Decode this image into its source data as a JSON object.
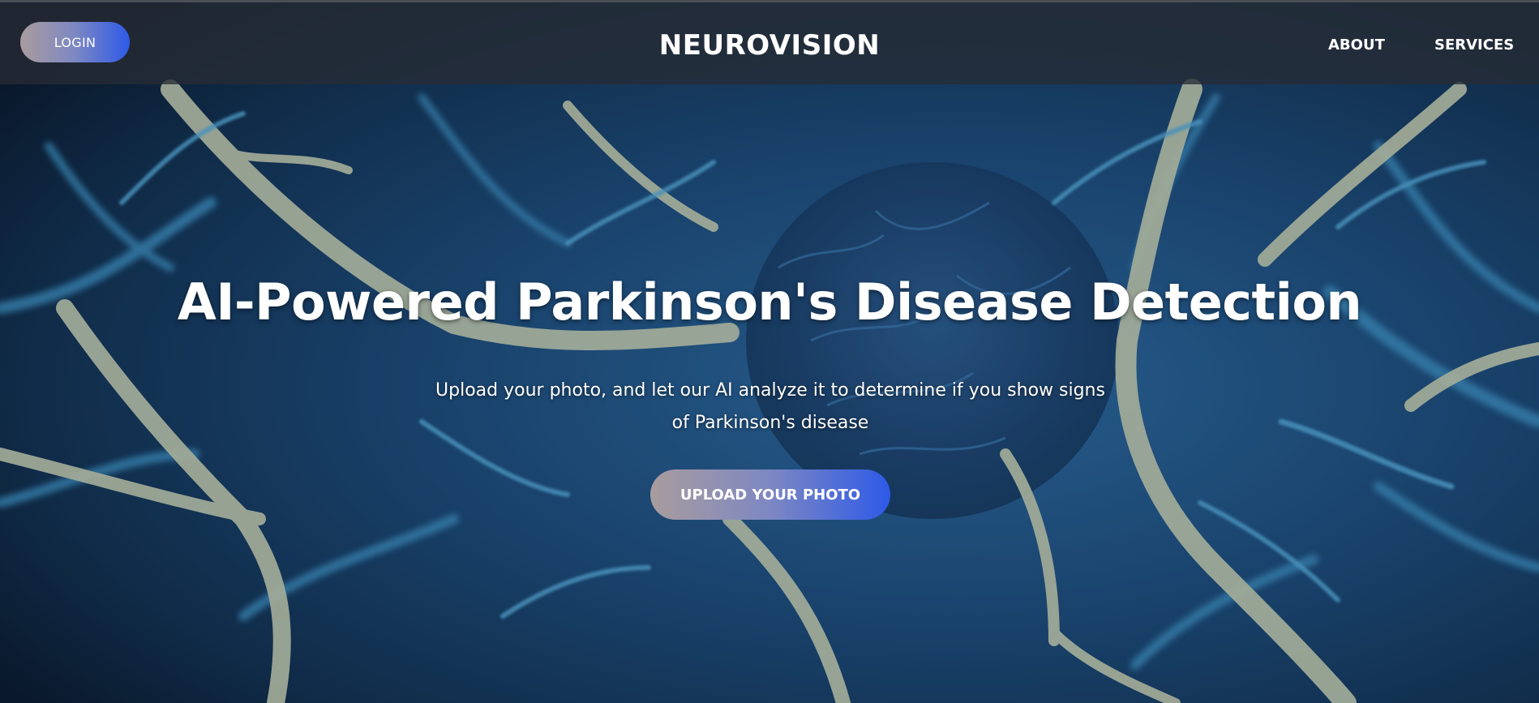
{
  "header": {
    "login_label": "LOGIN",
    "brand": "NEUROVISION",
    "nav": [
      {
        "label": "ABOUT"
      },
      {
        "label": "SERVICES"
      }
    ]
  },
  "hero": {
    "title": "AI-Powered Parkinson's Disease Detection",
    "subtitle": "Upload your photo, and let our AI analyze it to determine if you show signs of Parkinson's disease",
    "cta_label": "UPLOAD YOUR PHOTO"
  },
  "colors": {
    "button_gradient_start": "#a99c9e",
    "button_gradient_end": "#2e5ae8",
    "topbar": "#262c34",
    "background": "#0a1f35"
  }
}
